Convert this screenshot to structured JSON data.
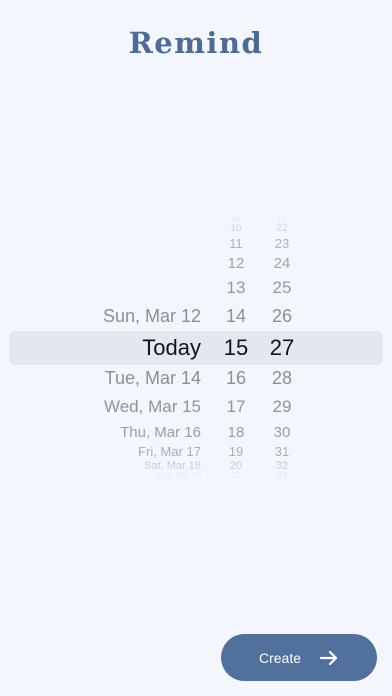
{
  "app": {
    "title": "Remind"
  },
  "picker": {
    "rows": [
      {
        "day": "",
        "hour": "09",
        "minute": "21"
      },
      {
        "day": "",
        "hour": "10",
        "minute": "22"
      },
      {
        "day": "",
        "hour": "11",
        "minute": "23"
      },
      {
        "day": "",
        "hour": "12",
        "minute": "24"
      },
      {
        "day": "",
        "hour": "13",
        "minute": "25"
      },
      {
        "day": "Sun, Mar 12",
        "hour": "14",
        "minute": "26"
      },
      {
        "day": "Today",
        "hour": "15",
        "minute": "27"
      },
      {
        "day": "Tue, Mar 14",
        "hour": "16",
        "minute": "28"
      },
      {
        "day": "Wed, Mar 15",
        "hour": "17",
        "minute": "29"
      },
      {
        "day": "Thu, Mar 16",
        "hour": "18",
        "minute": "30"
      },
      {
        "day": "Fri, Mar 17",
        "hour": "19",
        "minute": "31"
      },
      {
        "day": "Sat, Mar 18",
        "hour": "20",
        "minute": "32"
      },
      {
        "day": "Sun, Mar 19",
        "hour": "21",
        "minute": "33"
      }
    ],
    "selected": {
      "day": "Today",
      "hour": "15",
      "minute": "27"
    }
  },
  "create_button": {
    "label": "Create",
    "icon": "arrow-right-icon"
  },
  "colors": {
    "accent": "#51709c",
    "title": "#4d6b94",
    "background": "#f3f7fd",
    "selection": "#e3e7ee"
  }
}
